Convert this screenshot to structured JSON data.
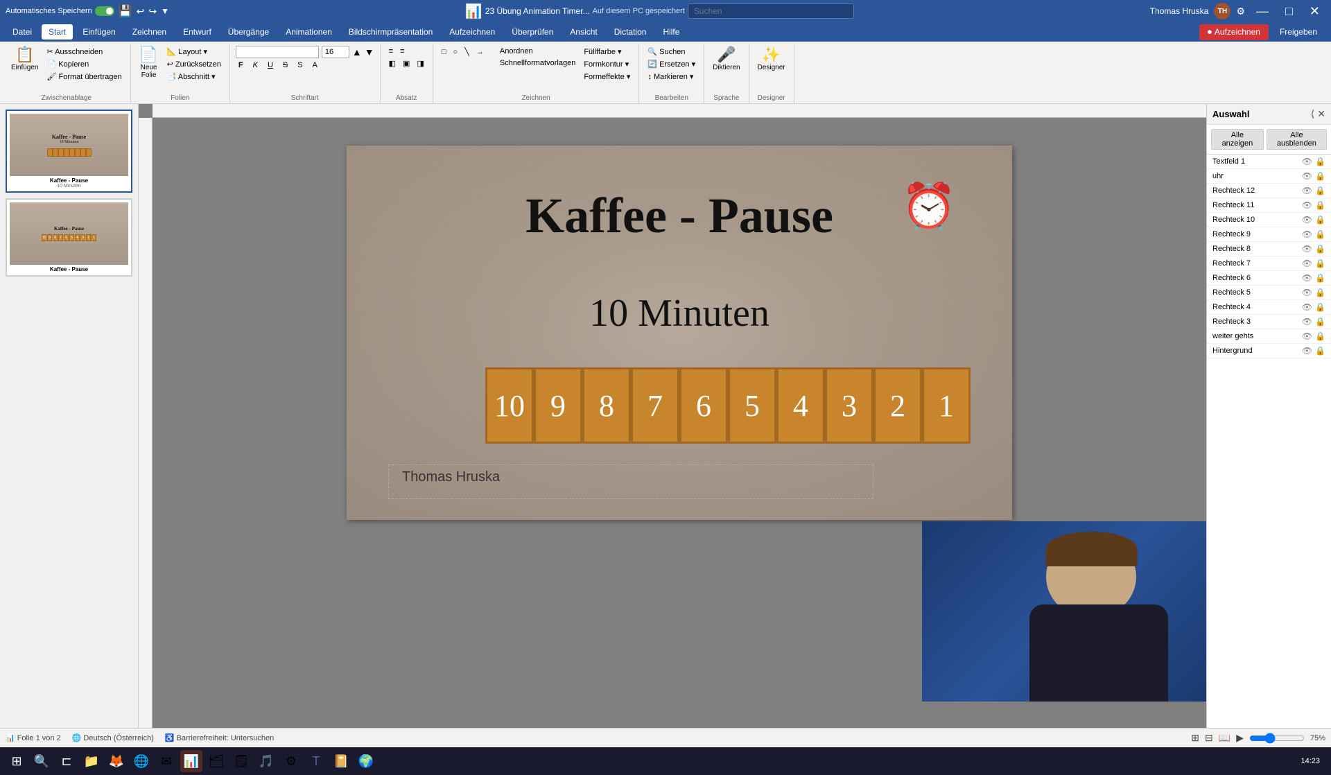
{
  "titlebar": {
    "autosave_label": "Automatisches Speichern",
    "filename": "23 Übung Animation Timer...",
    "save_location": "Auf diesem PC gespeichert",
    "user": "Thomas Hruska",
    "initials": "TH",
    "search_placeholder": "Suchen",
    "window_controls": {
      "minimize": "—",
      "maximize": "□",
      "close": "✕"
    }
  },
  "menubar": {
    "items": [
      {
        "label": "Datei",
        "active": false
      },
      {
        "label": "Start",
        "active": true
      },
      {
        "label": "Einfügen",
        "active": false
      },
      {
        "label": "Zeichnen",
        "active": false
      },
      {
        "label": "Entwurf",
        "active": false
      },
      {
        "label": "Übergänge",
        "active": false
      },
      {
        "label": "Animationen",
        "active": false
      },
      {
        "label": "Bildschirmpräsentation",
        "active": false
      },
      {
        "label": "Aufzeichnen",
        "active": false
      },
      {
        "label": "Überprüfen",
        "active": false
      },
      {
        "label": "Ansicht",
        "active": false
      },
      {
        "label": "Dictation",
        "active": false
      },
      {
        "label": "Hilfe",
        "active": false
      }
    ],
    "aufzeichnen_btn": "Aufzeichnen",
    "freigeben_btn": "Freigeben"
  },
  "ribbon": {
    "groups": [
      {
        "name": "Zwischenablage",
        "buttons": [
          {
            "icon": "📋",
            "label": "Einfügen"
          },
          {
            "icon": "✂️",
            "label": "Ausschneiden"
          },
          {
            "icon": "📄",
            "label": "Kopieren"
          },
          {
            "icon": "🖌️",
            "label": "Format übertragen"
          }
        ]
      },
      {
        "name": "Folien",
        "buttons": [
          {
            "icon": "📄",
            "label": "Neue Folie"
          },
          {
            "icon": "📐",
            "label": "Layout"
          },
          {
            "icon": "↩️",
            "label": "Zurücksetzen"
          },
          {
            "icon": "📑",
            "label": "Abschnitt"
          }
        ]
      },
      {
        "name": "Schriftart",
        "font": "",
        "font_size": "16",
        "buttons_bold": "F",
        "buttons_italic": "K",
        "buttons_underline": "U",
        "buttons_strikethrough": "S"
      },
      {
        "name": "Absatz",
        "buttons": [
          "≡",
          "≡",
          "≡",
          "≡"
        ]
      },
      {
        "name": "Zeichnen",
        "buttons": [
          "□",
          "○",
          "△",
          "→"
        ]
      },
      {
        "name": "Bearbeiten",
        "buttons": [
          {
            "icon": "🔍",
            "label": "Suchen"
          },
          {
            "icon": "🔄",
            "label": "Ersetzen"
          },
          {
            "icon": "↕",
            "label": "Markieren"
          }
        ]
      },
      {
        "name": "Sprache",
        "buttons": [
          {
            "icon": "🎤",
            "label": "Diktieren"
          }
        ]
      },
      {
        "name": "Designer",
        "buttons": [
          {
            "icon": "✨",
            "label": "Designer"
          }
        ]
      }
    ]
  },
  "slides": [
    {
      "number": 1,
      "title": "Kaffee - Pause",
      "subtitle": "10 Minuten",
      "active": true
    },
    {
      "number": 2,
      "title": "Kaffee - Pause",
      "active": false,
      "star": true
    }
  ],
  "slide": {
    "title": "Kaffee - Pause",
    "subtitle": "10 Minuten",
    "author": "Thomas Hruska",
    "timer_numbers": [
      "10",
      "9",
      "8",
      "7",
      "6",
      "5",
      "4",
      "3",
      "2",
      "1"
    ],
    "timer_color": "#c8852c",
    "alarm_icon": "⏰"
  },
  "selection_panel": {
    "title": "Auswahl",
    "btn_show_all": "Alle anzeigen",
    "btn_hide_all": "Alle ausblenden",
    "layers": [
      {
        "name": "Textfeld 1"
      },
      {
        "name": "uhr"
      },
      {
        "name": "Rechteck 12"
      },
      {
        "name": "Rechteck 11"
      },
      {
        "name": "Rechteck 10"
      },
      {
        "name": "Rechteck 9"
      },
      {
        "name": "Rechteck 8"
      },
      {
        "name": "Rechteck 7"
      },
      {
        "name": "Rechteck 6"
      },
      {
        "name": "Rechteck 5"
      },
      {
        "name": "Rechteck 4"
      },
      {
        "name": "Rechteck 3"
      },
      {
        "name": "weiter gehts"
      },
      {
        "name": "Hintergrund"
      }
    ]
  },
  "statusbar": {
    "slide_info": "Folie 1 von 2",
    "language": "Deutsch (Österreich)",
    "accessibility": "Barrierefreiheit: Untersuchen"
  },
  "taskbar": {
    "apps": [
      "⊞",
      "📁",
      "🦊",
      "🌐",
      "✉",
      "📊",
      "🗂",
      "🗒",
      "🎵",
      "🔵",
      "📎",
      "🔶",
      "🟦",
      "📰",
      "🖥",
      "🌍"
    ]
  }
}
